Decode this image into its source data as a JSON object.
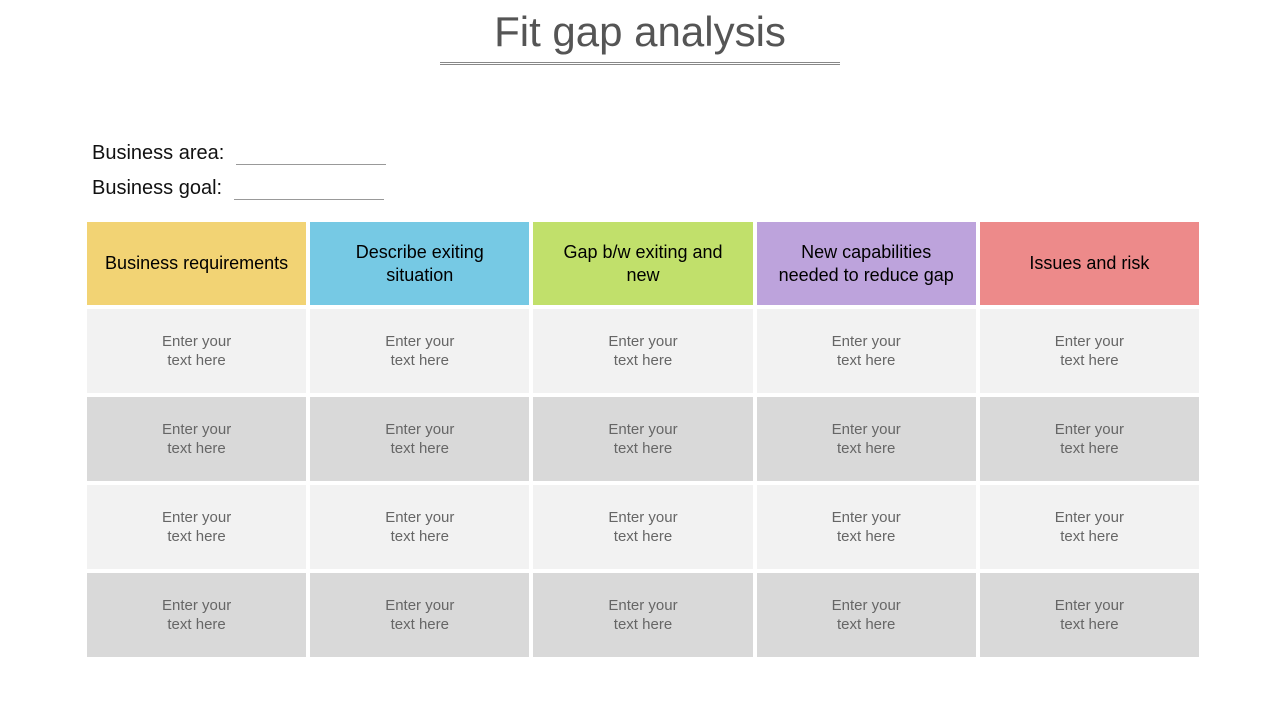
{
  "title": "Fit gap analysis",
  "meta": {
    "area_label": "Business area:",
    "goal_label": "Business goal:",
    "area_value": "",
    "goal_value": ""
  },
  "columns": [
    {
      "label": "Business requirements",
      "color": "#f2d374"
    },
    {
      "label": "Describe exiting situation",
      "color": "#76c9e4"
    },
    {
      "label": "Gap b/w exiting and new",
      "color": "#c1e06b"
    },
    {
      "label": "New capabilities needed to reduce gap",
      "color": "#bda3dc"
    },
    {
      "label": "Issues and risk",
      "color": "#ed8a8a"
    }
  ],
  "placeholder": "Enter your text here",
  "rows": 4
}
